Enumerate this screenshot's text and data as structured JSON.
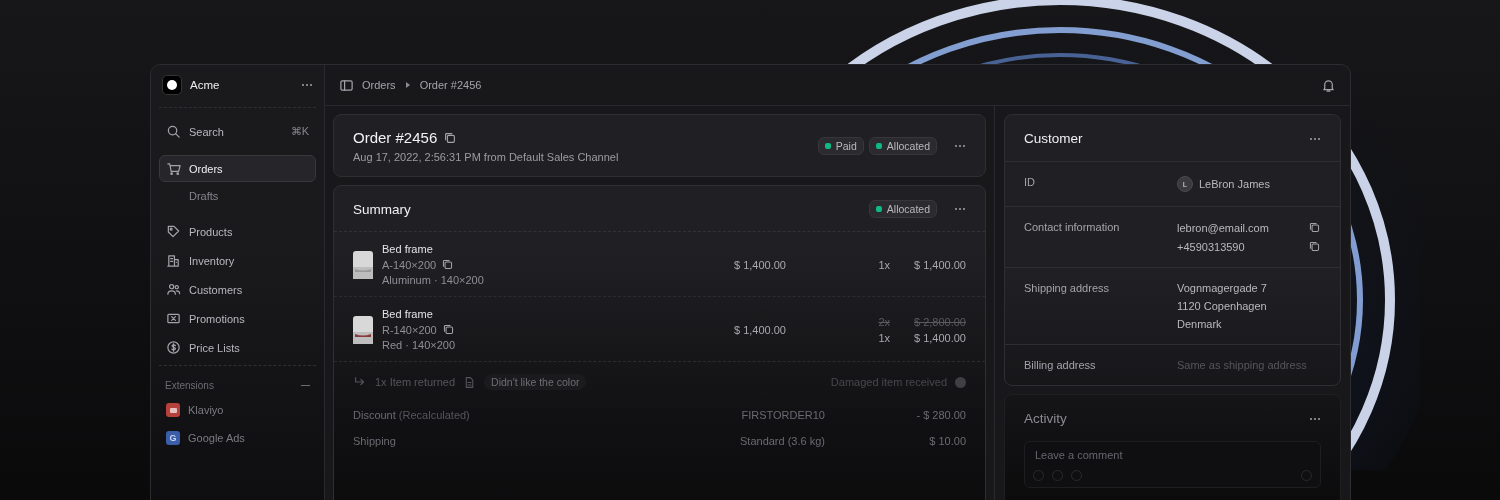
{
  "workspace": {
    "name": "Acme"
  },
  "nav": [
    {
      "kind": "search",
      "label": "Search",
      "shortcut": "⌘K",
      "selected": false
    },
    {
      "kind": "cart",
      "label": "Orders",
      "selected": true,
      "children": [
        {
          "label": "Drafts",
          "selected": false
        }
      ]
    },
    {
      "kind": "tag",
      "label": "Products",
      "selected": false
    },
    {
      "kind": "building",
      "label": "Inventory",
      "selected": false
    },
    {
      "kind": "users",
      "label": "Customers",
      "selected": false
    },
    {
      "kind": "ticket",
      "label": "Promotions",
      "selected": false
    },
    {
      "kind": "dollar",
      "label": "Price Lists",
      "selected": false
    }
  ],
  "extensions": {
    "title": "Extensions",
    "items": [
      {
        "label": "Klaviyo",
        "color": "#b5403c",
        "selected": false
      },
      {
        "label": "Google Ads",
        "color": "#3a5ea8",
        "badge": "G",
        "selected": false
      }
    ]
  },
  "breadcrumb": [
    "Orders",
    "Order #2456"
  ],
  "order": {
    "title": "Order #2456",
    "subtitle": "Aug 17, 2022, 2:56:31 PM from Default Sales Channel",
    "badges": [
      {
        "label": "Paid",
        "color": "#10b981"
      },
      {
        "label": "Allocated",
        "color": "#10b981"
      }
    ]
  },
  "summary": {
    "title": "Summary",
    "badges": [
      {
        "label": "Allocated",
        "color": "#10b981"
      }
    ],
    "items": [
      {
        "name": "Bed frame",
        "sku": "A-140×200",
        "variant": "Aluminum · 140×200",
        "price": "$ 1,400.00",
        "quantities": [
          {
            "text": "1x",
            "struck": false
          }
        ],
        "totals": [
          {
            "text": "$ 1,400.00",
            "struck": false
          }
        ]
      },
      {
        "name": "Bed frame",
        "sku": "R-140×200",
        "variant": "Red · 140×200",
        "price": "$ 1,400.00",
        "quantities": [
          {
            "text": "2x",
            "struck": true
          },
          {
            "text": "1x",
            "struck": false
          }
        ],
        "totals": [
          {
            "text": "$ 2,800.00",
            "struck": true
          },
          {
            "text": "$ 1,400.00",
            "struck": false
          }
        ]
      }
    ],
    "return": {
      "text": "1x Item returned",
      "tag": "Didn't like the color",
      "reason": "Damaged item received"
    },
    "totals": [
      {
        "label": "Discount",
        "note": "(Recalculated)",
        "detail": "FIRSTORDER10",
        "amount": "- $ 280.00"
      },
      {
        "label": "Shipping",
        "detail": "Standard (3.6 kg)",
        "amount": "$ 10.00"
      }
    ]
  },
  "customer": {
    "title": "Customer",
    "rows": [
      {
        "kind": "person",
        "label": "ID",
        "avatar": "L",
        "values": [
          "LeBron James"
        ]
      },
      {
        "kind": "copy",
        "label": "Contact information",
        "values": [
          "lebron@email.com",
          "+4590313590"
        ]
      },
      {
        "kind": "lines",
        "label": "Shipping address",
        "values": [
          "Vognmagergade 7",
          "1120 Copenhagen",
          "Denmark"
        ]
      },
      {
        "kind": "muted",
        "label": "Billing address",
        "values": [
          "Same as shipping address"
        ]
      }
    ]
  },
  "activity": {
    "title": "Activity",
    "placeholder": "Leave a comment"
  }
}
